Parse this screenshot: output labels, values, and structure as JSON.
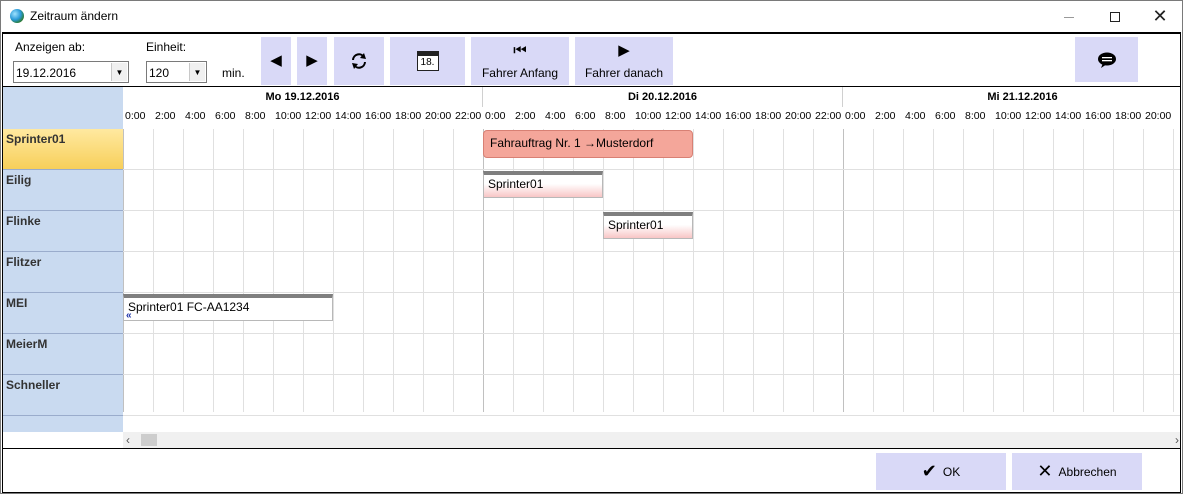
{
  "window": {
    "title": "Zeitraum ändern",
    "min_glyph": "—",
    "max_glyph": "☐",
    "close_glyph": "✕"
  },
  "toolbar": {
    "show_from_label": "Anzeigen ab:",
    "show_from_value": "19.12.2016",
    "unit_label": "Einheit:",
    "unit_value": "120",
    "unit_suffix": "min.",
    "btn_prev_icon": "triangle-left-icon",
    "btn_next_icon": "triangle-right-icon",
    "btn_refresh_icon": "refresh-icon",
    "btn_calendar_icon": "calendar-icon",
    "calendar_day": "18.",
    "btn_driver_start_label": "Fahrer Anfang",
    "btn_driver_after_label": "Fahrer danach",
    "btn_comment_icon": "speech-bubble-icon"
  },
  "schedule": {
    "days": [
      "Mo 19.12.2016",
      "Di 20.12.2016",
      "Mi 21.12.2016"
    ],
    "hours": [
      "0:00",
      "2:00",
      "4:00",
      "6:00",
      "8:00",
      "10:00",
      "12:00",
      "14:00",
      "16:00",
      "18:00",
      "20:00",
      "22:00"
    ],
    "resources": [
      "Sprinter01",
      "Eilig",
      "Flinke",
      "Flitzer",
      "MEI",
      "MeierM",
      "Schneller"
    ],
    "selected_resource": "Sprinter01",
    "appointments": [
      {
        "resource": "Sprinter01",
        "text": "Fahrauftrag Nr. 1  →Musterdorf",
        "start": "20.12.2016 0:00",
        "end": "20.12.2016 14:00",
        "style": "big"
      },
      {
        "resource": "Eilig",
        "text": "Sprinter01",
        "start": "20.12.2016 0:00",
        "end": "20.12.2016 8:00",
        "style": "bar"
      },
      {
        "resource": "Flinke",
        "text": "Sprinter01",
        "start": "20.12.2016 8:00",
        "end": "20.12.2016 14:00",
        "style": "bar"
      },
      {
        "resource": "MEI",
        "text": "Sprinter01 FC-AA1234",
        "start": "19.12.2016 0:00",
        "end": "19.12.2016 14:00",
        "style": "white",
        "continued": "«"
      }
    ],
    "scroll_left": "‹",
    "scroll_right": "›"
  },
  "footer": {
    "ok_label": "OK",
    "ok_icon": "check-icon",
    "cancel_label": "Abbrechen",
    "cancel_icon": "close-icon"
  }
}
